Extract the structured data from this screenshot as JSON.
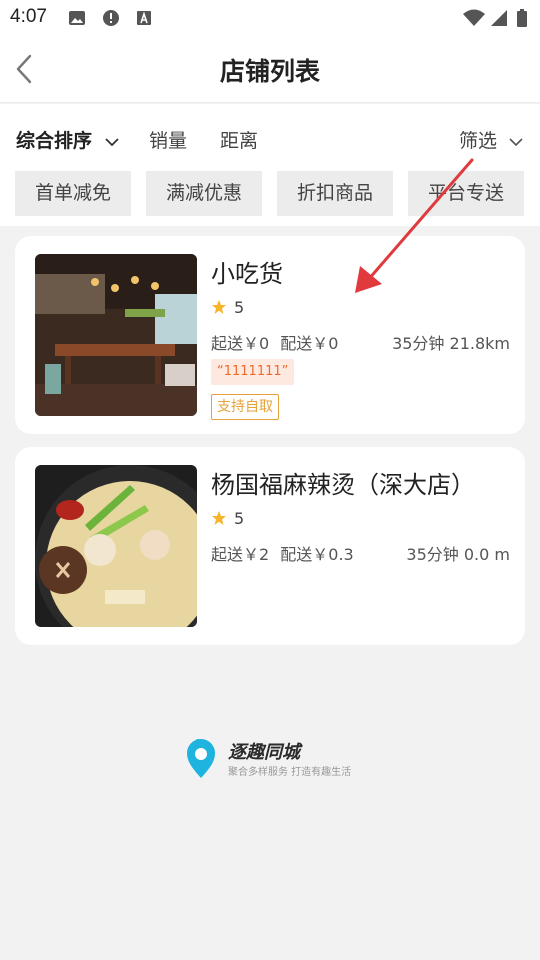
{
  "status_bar": {
    "time": "4:07",
    "left_icons": [
      "image-icon",
      "alert-icon",
      "text-a-icon"
    ],
    "right_icons": [
      "wifi-icon",
      "signal-icon",
      "battery-icon"
    ]
  },
  "header": {
    "title": "店铺列表",
    "back_icon": "chevron-left-icon"
  },
  "sort_bar": {
    "items": [
      {
        "label": "综合排序",
        "active": true,
        "has_dropdown": true
      },
      {
        "label": "销量",
        "active": false
      },
      {
        "label": "距离",
        "active": false
      }
    ],
    "filter_label": "筛选",
    "tags": [
      "首单减免",
      "满减优惠",
      "折扣商品",
      "平台专送"
    ]
  },
  "shops": [
    {
      "name": "小吃货",
      "rating": "5",
      "min_order": "起送￥0",
      "delivery_fee": "配送￥0",
      "time_distance": "35分钟 21.8km",
      "promo": "“1111111”",
      "pickup": "支持自取",
      "image": "restaurant-interior-photo"
    },
    {
      "name": "杨国福麻辣烫（深大店）",
      "rating": "5",
      "min_order": "起送￥2",
      "delivery_fee": "配送￥0.3",
      "time_distance": "35分钟 0.0 m",
      "image": "hotpot-soup-photo"
    }
  ],
  "footer": {
    "brand": "逐趣同城",
    "slogan": "聚合多样服务 打造有趣生活"
  },
  "colors": {
    "accent_orange": "#f06a2d",
    "pickup_border": "#e6a23c",
    "star": "#f7b52c",
    "logo_blue": "#1fb3e0",
    "annotation_arrow": "#e0393e"
  }
}
